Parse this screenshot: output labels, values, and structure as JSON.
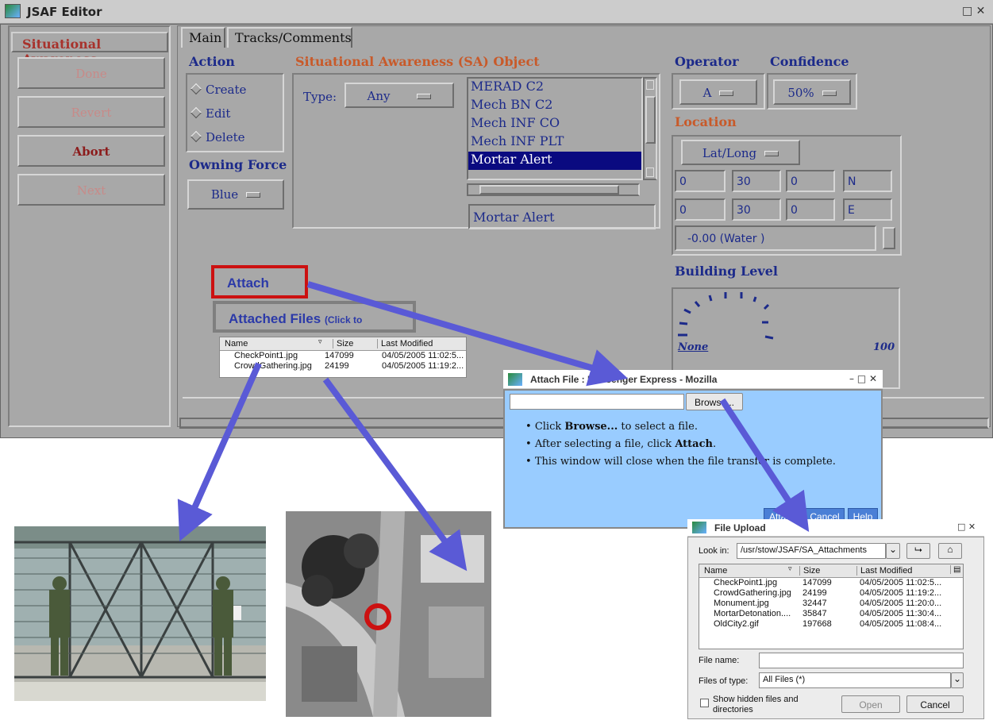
{
  "app": {
    "title": "JSAF Editor",
    "controls": "□ ✕"
  },
  "left_panel": {
    "header": "Situational Awareness",
    "buttons": {
      "done": "Done",
      "revert": "Revert",
      "abort": "Abort",
      "next": "Next"
    }
  },
  "tabs": {
    "main": "Main",
    "tracks": "Tracks/Comments"
  },
  "action": {
    "label": "Action",
    "create": "Create",
    "edit": "Edit",
    "delete": "Delete"
  },
  "owning_force": {
    "label": "Owning Force",
    "value": "Blue"
  },
  "sa_object": {
    "label": "Situational Awareness (SA) Object",
    "type_label": "Type:",
    "type_value": "Any",
    "items": [
      "MERAD C2",
      "Mech BN C2",
      "Mech INF CO",
      "Mech INF PLT",
      "Mortar Alert"
    ],
    "selected_index": 4,
    "name_value": "Mortar Alert"
  },
  "operator": {
    "label": "Operator",
    "value": "A"
  },
  "confidence": {
    "label": "Confidence",
    "value": "50%"
  },
  "location": {
    "label": "Location",
    "format": "Lat/Long",
    "lat": [
      "0",
      "30",
      "0",
      "N"
    ],
    "lon": [
      "0",
      "30",
      "0",
      "E"
    ],
    "elevation": "-0.00 (Water        )"
  },
  "building_level": {
    "label": "Building Level",
    "min_label": "None",
    "max_label": "100"
  },
  "attach": {
    "button": "Attach",
    "files_label": "Attached Files",
    "files_hint": "(Click to",
    "columns": [
      "Name",
      "Size",
      "Last Modified"
    ],
    "rows": [
      {
        "name": "CheckPoint1.jpg",
        "size": "147099",
        "modified": "04/05/2005 11:02:5..."
      },
      {
        "name": "CrowdGathering.jpg",
        "size": "24199",
        "modified": "04/05/2005 11:19:2..."
      }
    ]
  },
  "attach_dialog": {
    "title": "Attach File : Messenger Express - Mozilla",
    "browse": "Browse...",
    "line1_pre": "Click ",
    "line1_bold": "Browse...",
    "line1_post": " to select a file.",
    "line2_pre": "After selecting a file, click ",
    "line2_bold": "Attach",
    "line2_post": ".",
    "line3": "This window will close when the file transfer is complete.",
    "buttons": {
      "attach": "Attach",
      "cancel": "Cancel",
      "help": "Help"
    }
  },
  "file_upload": {
    "title": "File Upload",
    "look_in_label": "Look in:",
    "look_in_value": "/usr/stow/JSAF/SA_Attachments",
    "columns": [
      "Name",
      "Size",
      "Last Modified"
    ],
    "rows": [
      {
        "name": "CheckPoint1.jpg",
        "size": "147099",
        "modified": "04/05/2005 11:02:5..."
      },
      {
        "name": "CrowdGathering.jpg",
        "size": "24199",
        "modified": "04/05/2005 11:19:2..."
      },
      {
        "name": "Monument.jpg",
        "size": "32447",
        "modified": "04/05/2005 11:20:0..."
      },
      {
        "name": "MortarDetonation....",
        "size": "35847",
        "modified": "04/05/2005 11:30:4..."
      },
      {
        "name": "OldCity2.gif",
        "size": "197668",
        "modified": "04/05/2005 11:08:4..."
      }
    ],
    "file_name_label": "File name:",
    "file_name_value": "",
    "files_of_type_label": "Files of type:",
    "files_of_type_value": "All Files (*)",
    "show_hidden": "Show hidden files and directories",
    "open": "Open",
    "cancel": "Cancel"
  },
  "colors": {
    "annotation_arrow": "#5a5ad6",
    "highlight_box": "#cc1111",
    "dialog_bg": "#99ccff"
  }
}
